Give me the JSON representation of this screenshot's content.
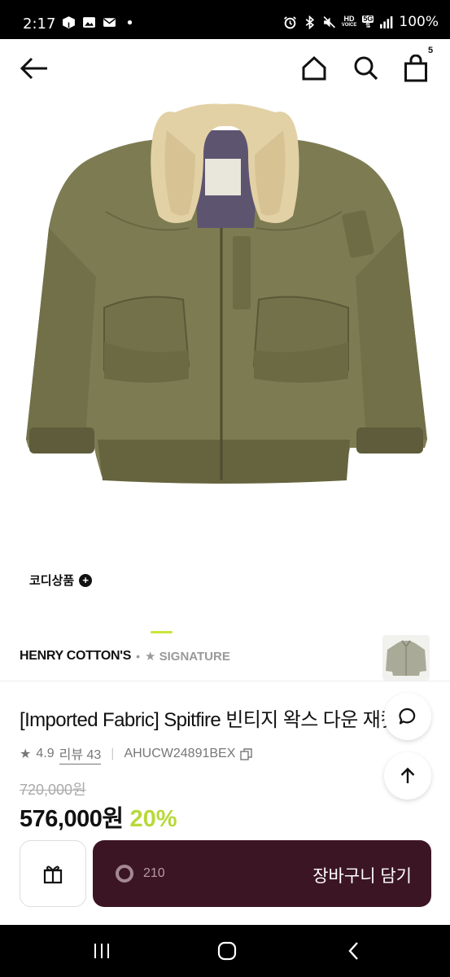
{
  "status_bar": {
    "time": "2:17",
    "battery": "100%",
    "network_label_top": "HD",
    "network_label_bottom": "VOICE",
    "network_type": "5G"
  },
  "nav": {
    "cart_count": "5"
  },
  "coordi_label": "코디상품",
  "brand": {
    "name": "HENRY COTTON'S",
    "dot": "•",
    "signature": "★ SIGNATURE"
  },
  "product": {
    "title": "[Imported Fabric] Spitfire 빈티지 왁스 다운 재킷",
    "rating": "4.9",
    "review_label": "리뷰 43",
    "code": "AHUCW24891BEX",
    "original_price": "720,000원",
    "sale_price": "576,000원",
    "discount": "20%"
  },
  "actions": {
    "like_count": "210",
    "add_to_cart": "장바구니 담기"
  },
  "colors": {
    "accent": "#c8e63c",
    "discount": "#b7d93a",
    "cart_button": "#3c1524",
    "jacket": "#7d7b52"
  }
}
